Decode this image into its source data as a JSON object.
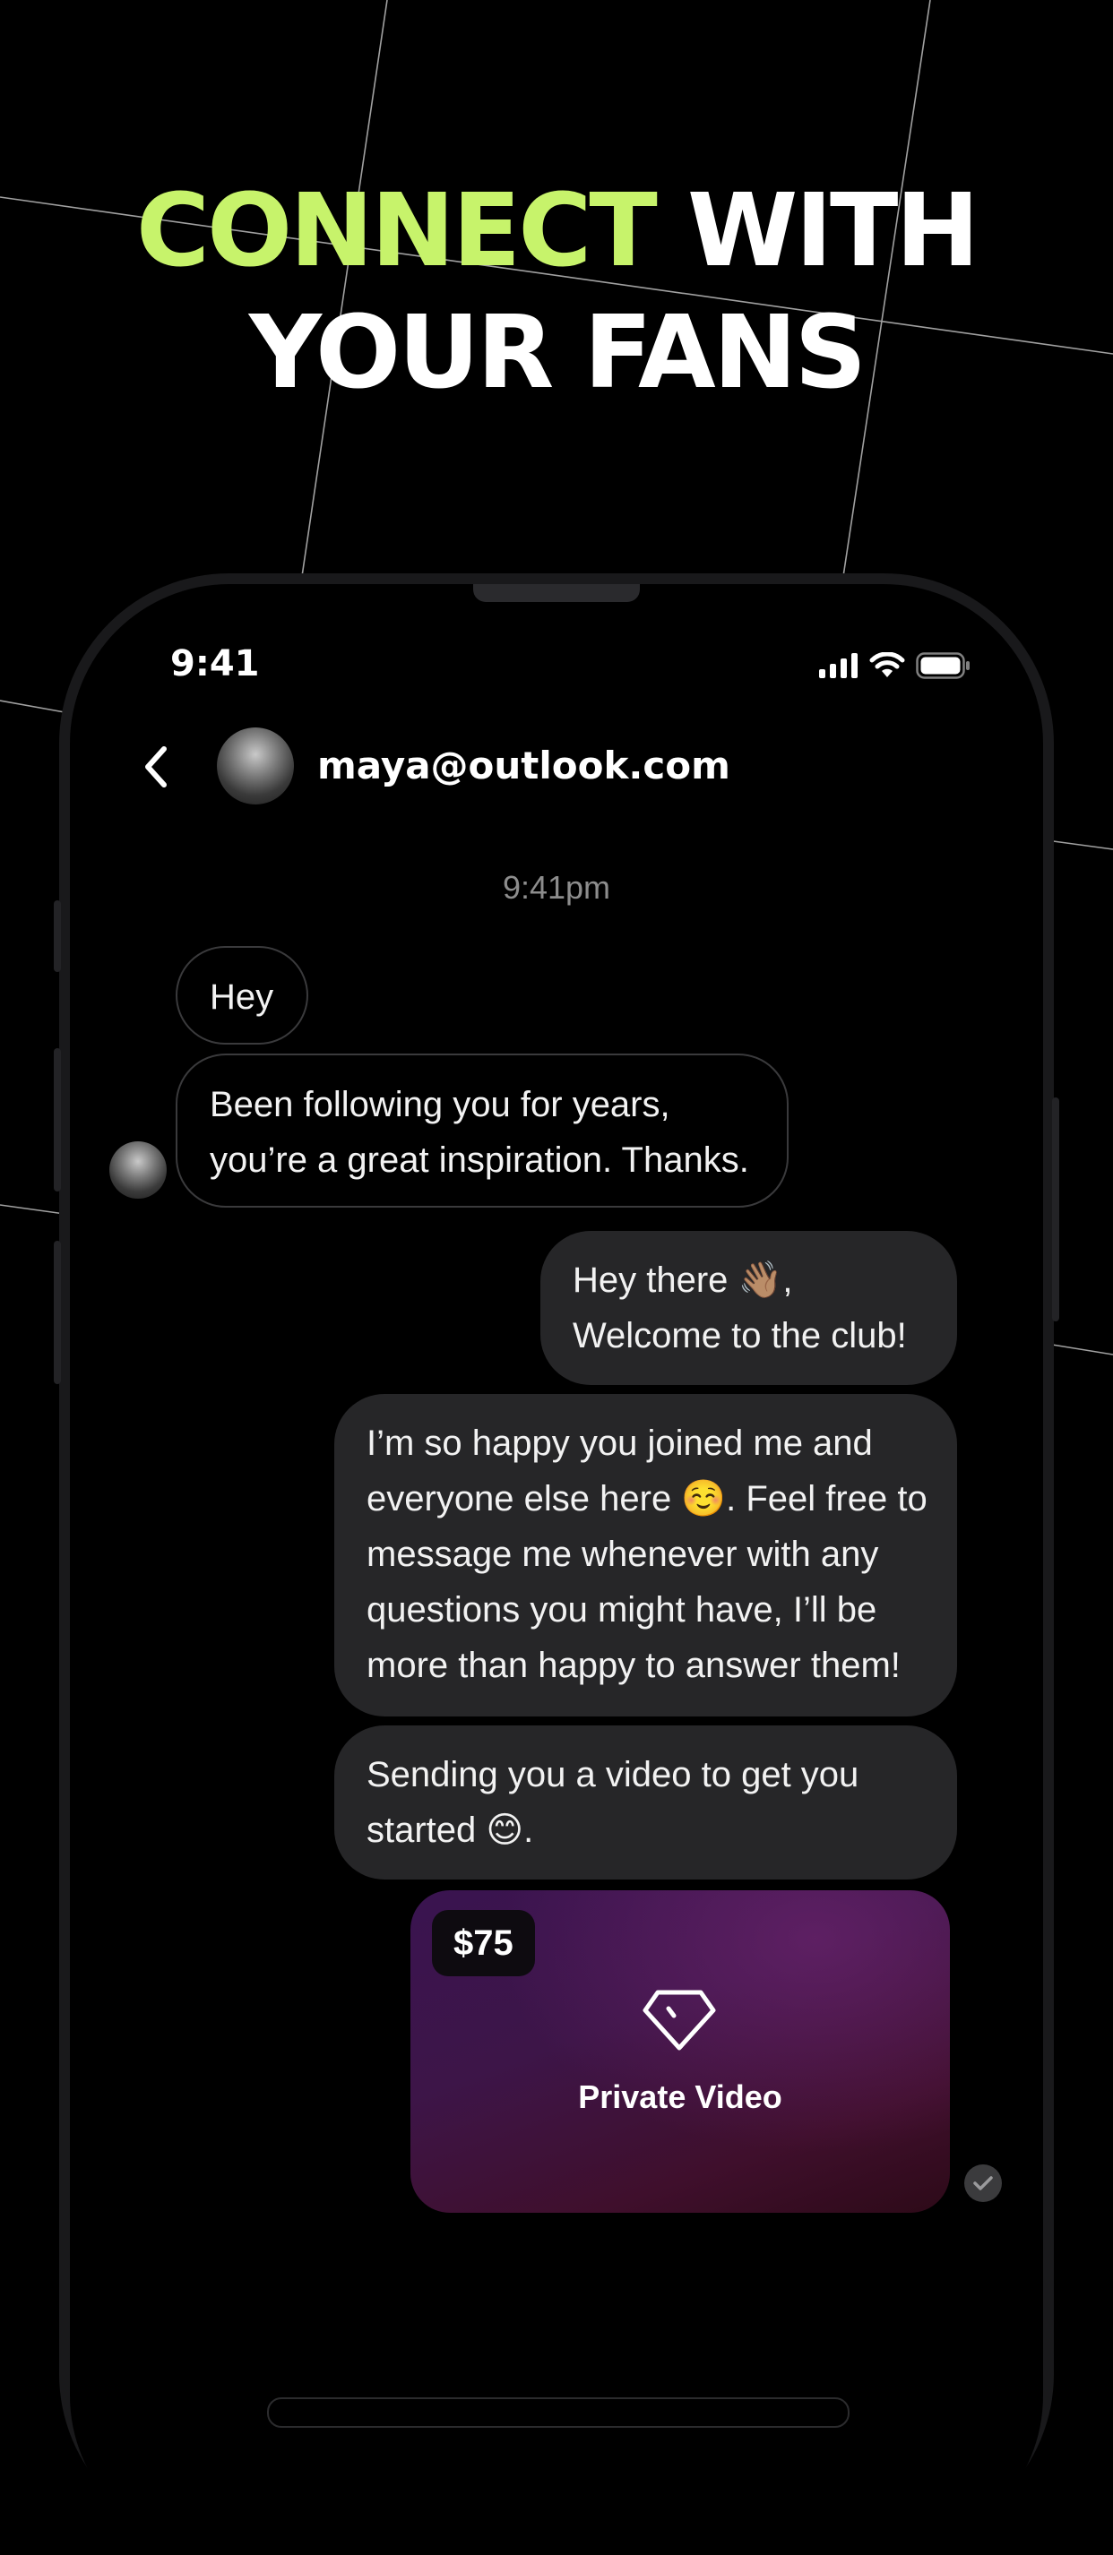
{
  "headline": {
    "accent_text": "CONNECT",
    "rest_line1": "WITH",
    "line2": "YOUR FANS",
    "accent_color": "#c7f36b"
  },
  "status_bar": {
    "time": "9:41",
    "icons": [
      "cellular-signal-icon",
      "wifi-icon",
      "battery-icon"
    ]
  },
  "chat_header": {
    "back_icon": "chevron-left-icon",
    "contact_name": "maya@outlook.com"
  },
  "conversation": {
    "timestamp": "9:41pm",
    "incoming": [
      {
        "text": "Hey"
      },
      {
        "text": "Been following you for years,\nyou’re a great inspiration. Thanks."
      }
    ],
    "outgoing": [
      {
        "text": "Hey there 👋🏽,\nWelcome to the club!"
      },
      {
        "text": "I’m so happy you joined me and\neveryone else here ☺️. Feel free to\nmessage me whenever with any\nquestions you might have, I’ll be\nmore than happy to answer them!"
      },
      {
        "text": "Sending you a video to get you\nstarted 😊."
      }
    ],
    "video_message": {
      "price": "$75",
      "label": "Private Video",
      "icon": "diamond-icon"
    },
    "read_receipt_icon": "checkmark-icon"
  }
}
